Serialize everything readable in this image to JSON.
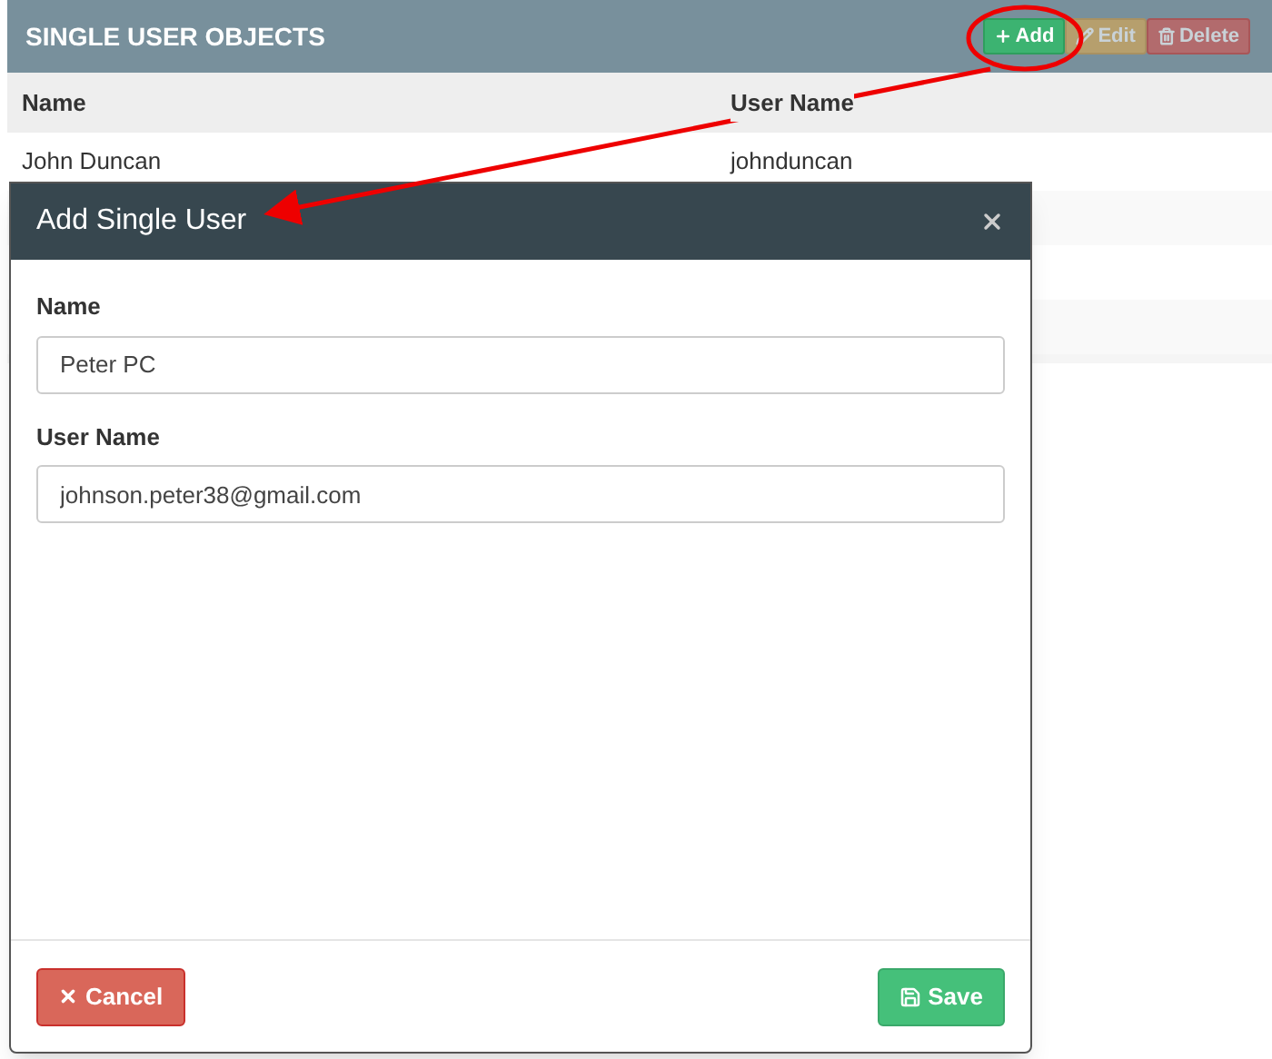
{
  "panel": {
    "title": "SINGLE USER OBJECTS",
    "actions": [
      {
        "kind": "add",
        "label": "Add",
        "disabled": false
      },
      {
        "kind": "edit",
        "label": "Edit",
        "disabled": true
      },
      {
        "kind": "delete",
        "label": "Delete",
        "disabled": true
      }
    ]
  },
  "table": {
    "columns": [
      "Name",
      "User Name"
    ],
    "rows": [
      [
        "John Duncan",
        "johnduncan"
      ]
    ]
  },
  "dialog": {
    "title": "Add Single User",
    "fields": [
      {
        "label": "Name",
        "value": "Peter PC"
      },
      {
        "label": "User Name",
        "value": "johnson.peter38@gmail.com"
      }
    ],
    "cancel": "Cancel",
    "save": "Save"
  }
}
